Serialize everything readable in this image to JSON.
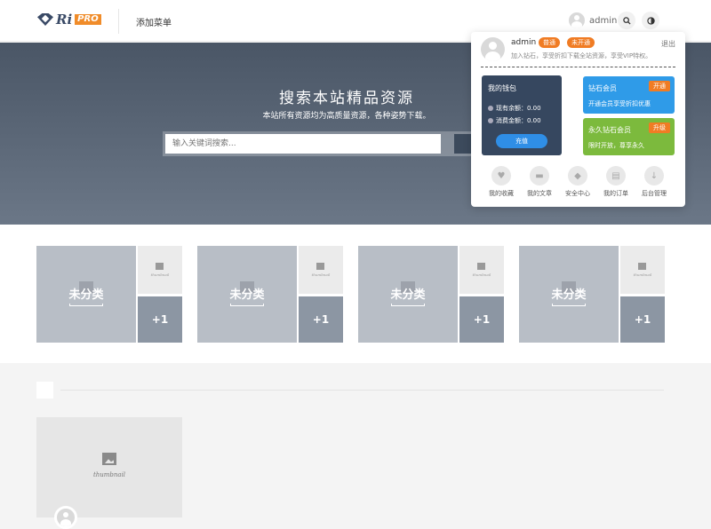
{
  "header": {
    "logo_text": "Ri",
    "logo_badge": "PRO",
    "add_menu": "添加菜单",
    "username": "admin",
    "search_icon": "search-icon",
    "theme_icon": "theme-toggle-icon"
  },
  "hero": {
    "title": "搜索本站精品资源",
    "subtitle": "本站所有资源均为高质量资源，各种姿势下载。",
    "search_placeholder": "输入关键词搜索..."
  },
  "categories": [
    {
      "title": "未分类",
      "thumb": "thumbnail",
      "more": "+1"
    },
    {
      "title": "未分类",
      "thumb": "thumbnail",
      "more": "+1"
    },
    {
      "title": "未分类",
      "thumb": "thumbnail",
      "more": "+1"
    },
    {
      "title": "未分类",
      "thumb": "thumbnail",
      "more": "+1"
    }
  ],
  "post": {
    "thumb": "thumbnail"
  },
  "panel": {
    "username": "admin",
    "badge_normal": "普通",
    "badge_inactive": "未开通",
    "logout": "退出",
    "desc": "加入钻石，享受折扣下载全站资源，享受VIP特权。",
    "wallet": {
      "title": "我的钱包",
      "balance_label": "现有余额：0.00",
      "spent_label": "消费金额：0.00",
      "recharge": "充值"
    },
    "vip": {
      "title": "钻石会员",
      "desc": "开通会员享受折扣优惠",
      "action": "开通",
      "color": "#2f9be8"
    },
    "lifetime": {
      "title": "永久钻石会员",
      "desc": "限时开放，尊享永久",
      "action": "升级",
      "color": "#7cba3d"
    },
    "quick": [
      {
        "label": "我的收藏",
        "icon": "heart-icon"
      },
      {
        "label": "我的文章",
        "icon": "folder-icon"
      },
      {
        "label": "安全中心",
        "icon": "shield-icon"
      },
      {
        "label": "我的订单",
        "icon": "clipboard-icon"
      },
      {
        "label": "后台管理",
        "icon": "download-icon"
      }
    ]
  }
}
